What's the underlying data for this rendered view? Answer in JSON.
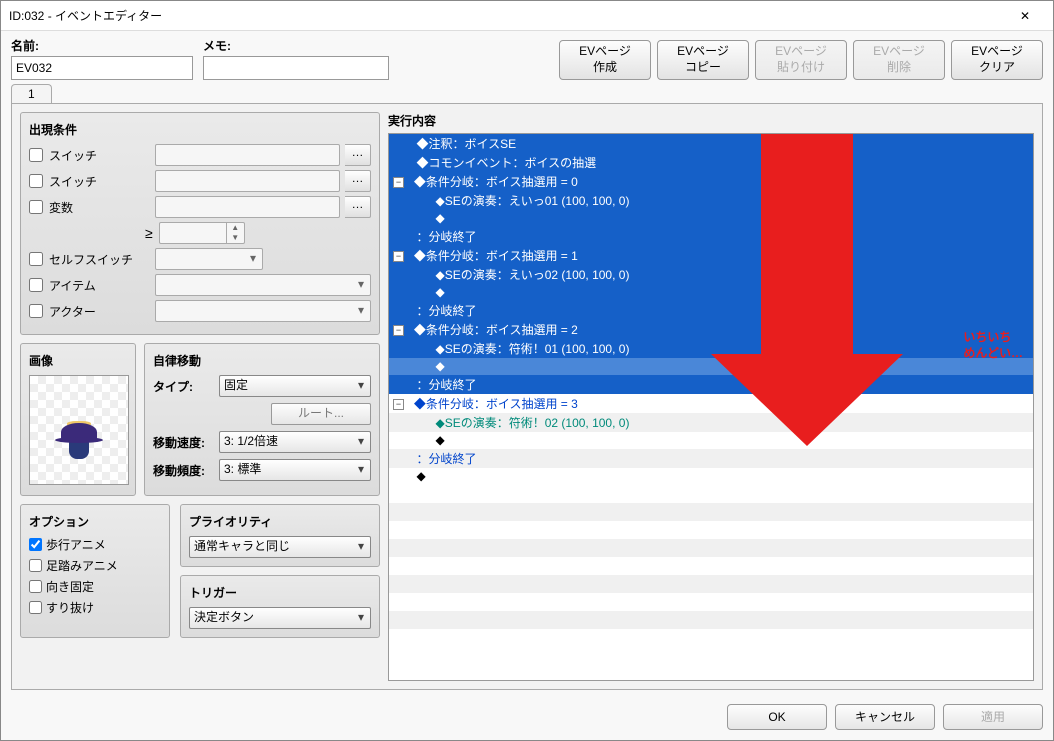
{
  "titlebar": {
    "title": "ID:032 - イベントエディター"
  },
  "header": {
    "name_label": "名前:",
    "name_value": "EV032",
    "memo_label": "メモ:",
    "memo_value": "",
    "buttons": {
      "create": "EVページ\n作成",
      "copy": "EVページ\nコピー",
      "paste": "EVページ\n貼り付け",
      "delete": "EVページ\n削除",
      "clear": "EVページ\nクリア"
    }
  },
  "tabs": {
    "t1": "1"
  },
  "conditions": {
    "title": "出現条件",
    "switch1": "スイッチ",
    "switch2": "スイッチ",
    "variable": "変数",
    "ge": "≥",
    "self_switch": "セルフスイッチ",
    "item": "アイテム",
    "actor": "アクター"
  },
  "image": {
    "title": "画像"
  },
  "auto": {
    "title": "自律移動",
    "type_label": "タイプ:",
    "type_value": "固定",
    "route": "ルート...",
    "speed_label": "移動速度:",
    "speed_value": "3: 1/2倍速",
    "freq_label": "移動頻度:",
    "freq_value": "3: 標準"
  },
  "options": {
    "title": "オプション",
    "walk": "歩行アニメ",
    "step": "足踏みアニメ",
    "dir": "向き固定",
    "through": "すり抜け"
  },
  "priority": {
    "title": "プライオリティ",
    "value": "通常キャラと同じ"
  },
  "trigger": {
    "title": "トリガー",
    "value": "決定ボタン"
  },
  "exec": {
    "title": "実行内容",
    "lines": [
      "◆注釈：ボイスSE",
      "◆コモンイベント：ボイスの抽選",
      "◆条件分岐：ボイス抽選用 = 0",
      "  ◆SEの演奏：えいっ01 (100, 100, 0)",
      "  ◆",
      "：分岐終了",
      "◆条件分岐：ボイス抽選用 = 1",
      "  ◆SEの演奏：えいっ02 (100, 100, 0)",
      "  ◆",
      "：分岐終了",
      "◆条件分岐：ボイス抽選用 = 2",
      "  ◆SEの演奏：符術！01 (100, 100, 0)",
      "  ◆",
      "：分岐終了",
      "◆条件分岐：ボイス抽選用 = 3",
      "  ◆SEの演奏：符術！02 (100, 100, 0)",
      "  ◆",
      "：分岐終了",
      "◆"
    ]
  },
  "annotation": {
    "line1": "いちいち",
    "line2": "めんどい…"
  },
  "footer": {
    "ok": "OK",
    "cancel": "キャンセル",
    "apply": "適用"
  }
}
